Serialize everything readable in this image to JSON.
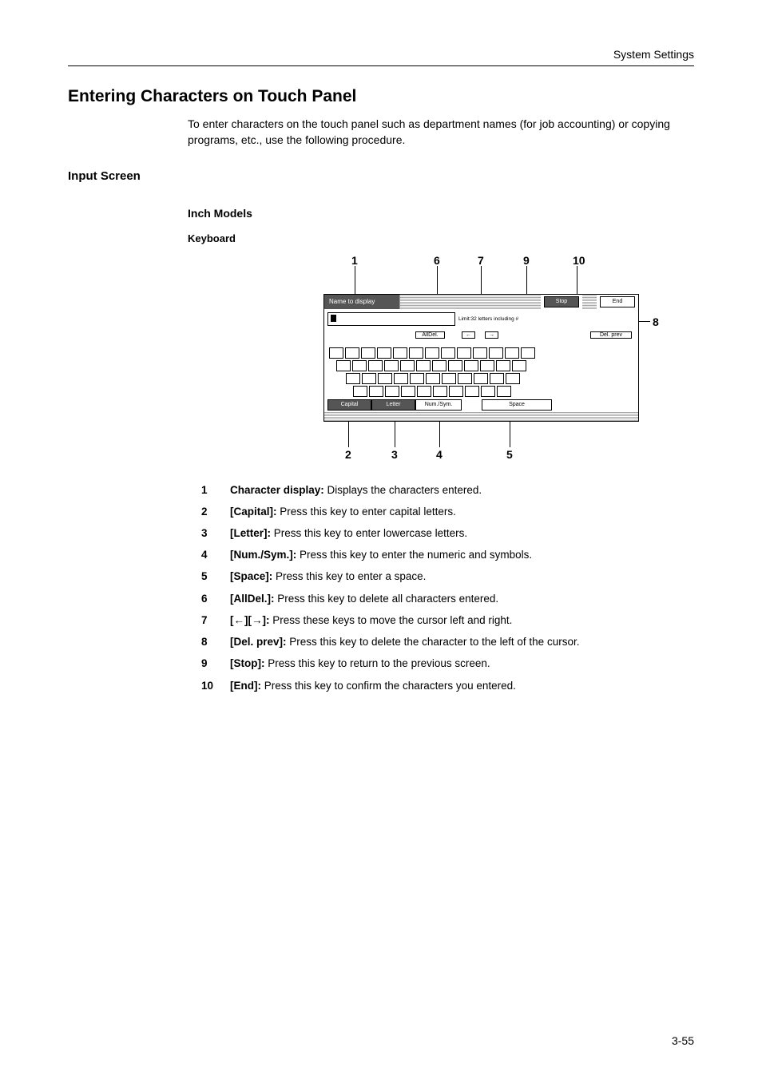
{
  "header": {
    "section": "System Settings"
  },
  "title": "Entering Characters on Touch Panel",
  "intro": "To enter characters on the touch panel such as department names (for job accounting) or copying programs, etc., use the following procedure.",
  "h2": "Input Screen",
  "h3": "Inch Models",
  "kbd_label": "Keyboard",
  "panel": {
    "name_to_display": "Name to display",
    "stop": "Stop",
    "end": "End",
    "limit": "Limit:32 letters including #",
    "all_del": "AllDel.",
    "arrow_left": "←",
    "arrow_right": "→",
    "del_prev": "Del. prev",
    "tab_capital": "Capital",
    "tab_letter": "Letter",
    "tab_numsym": "Num./Sym.",
    "tab_space": "Space"
  },
  "callouts": {
    "top": {
      "c1": "1",
      "c6": "6",
      "c7": "7",
      "c9": "9",
      "c10": "10"
    },
    "right": {
      "c8": "8"
    },
    "bottom": {
      "c2": "2",
      "c3": "3",
      "c4": "4",
      "c5": "5"
    }
  },
  "items": [
    {
      "n": "1",
      "strong": "Character display:",
      "rest": " Displays the characters entered."
    },
    {
      "n": "2",
      "strong": "[Capital]:",
      "rest": " Press this key to enter capital letters."
    },
    {
      "n": "3",
      "strong": "[Letter]:",
      "rest": " Press this key to enter lowercase letters."
    },
    {
      "n": "4",
      "strong": "[Num./Sym.]:",
      "rest": " Press this key to enter the numeric and symbols."
    },
    {
      "n": "5",
      "strong": "[Space]:",
      "rest": " Press this key to enter a space."
    },
    {
      "n": "6",
      "strong": "[AllDel.]:",
      "rest": " Press this key to delete all characters entered."
    },
    {
      "n": "7",
      "strong": "[←][→]:",
      "rest": " Press these keys to move the cursor left and right."
    },
    {
      "n": "8",
      "strong": "[Del. prev]:",
      "rest": " Press this key to delete the character to the left of the cursor."
    },
    {
      "n": "9",
      "strong": "[Stop]:",
      "rest": " Press this key to return to the previous screen."
    },
    {
      "n": "10",
      "strong": "[End]:",
      "rest": " Press this key to confirm the characters you entered."
    }
  ],
  "page_number": "3-55"
}
